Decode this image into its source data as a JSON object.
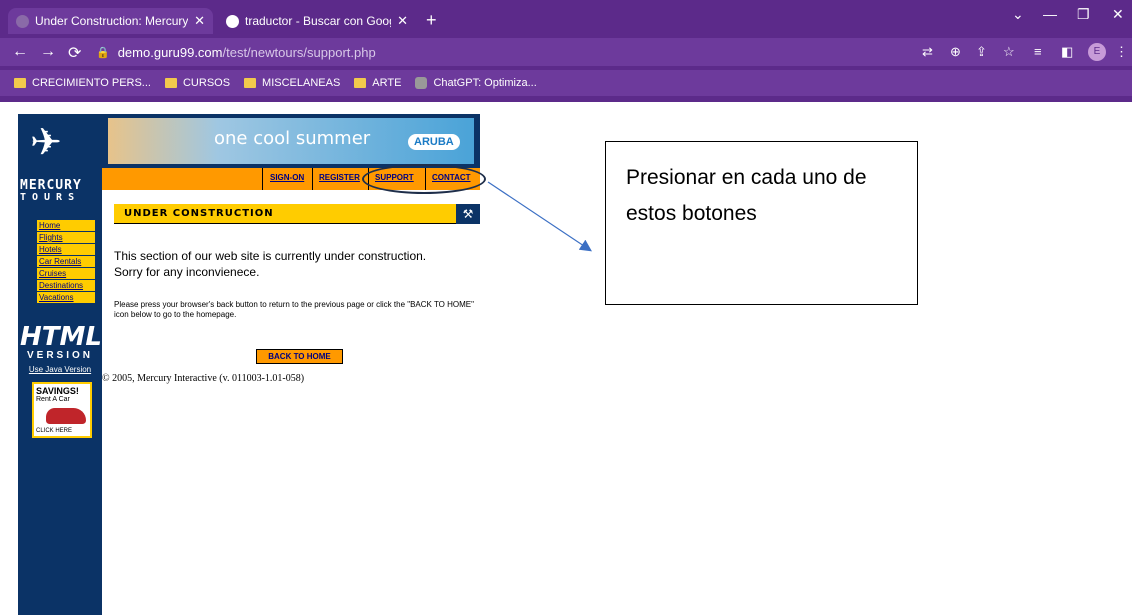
{
  "browser": {
    "tabs": [
      {
        "title": "Under Construction: Mercury To",
        "active": true
      },
      {
        "title": "traductor - Buscar con Google",
        "active": false
      }
    ],
    "url_host": "demo.guru99.com",
    "url_path": "/test/newtours/support.php",
    "profile_initial": "E",
    "bookmarks": [
      "CRECIMIENTO PERS...",
      "CURSOS",
      "MISCELANEAS",
      "ARTE",
      "ChatGPT: Optimiza..."
    ]
  },
  "site": {
    "logo_line1": "MERCURY",
    "logo_line2": "TOURS",
    "banner_text": "one cool summer",
    "banner_badge": "ARUBA",
    "top_nav": [
      "SIGN-ON",
      "REGISTER",
      "SUPPORT",
      "CONTACT"
    ],
    "side_nav": [
      "Home",
      "Flights",
      "Hotels",
      "Car Rentals",
      "Cruises",
      "Destinations",
      "Vacations"
    ],
    "html_badge_big": "HTML",
    "html_badge_small": "VERSION",
    "java_link": "Use Java Version",
    "savings_title": "SAVINGS!",
    "savings_sub": "Rent A Car",
    "savings_click": "CLICK HERE",
    "section_title": "UNDER CONSTRUCTION",
    "message": "This section of our web site is currently under construction.  Sorry for any inconvienece.",
    "instructions": "Please press your browser's back button to return to the previous page or click the \"BACK TO HOME\" icon below to go to the homepage.",
    "back_home": "BACK TO HOME",
    "copyright": "© 2005, Mercury Interactive (v. 011003-1.01-058)"
  },
  "annotation": {
    "note": "Presionar en cada uno de estos botones"
  }
}
